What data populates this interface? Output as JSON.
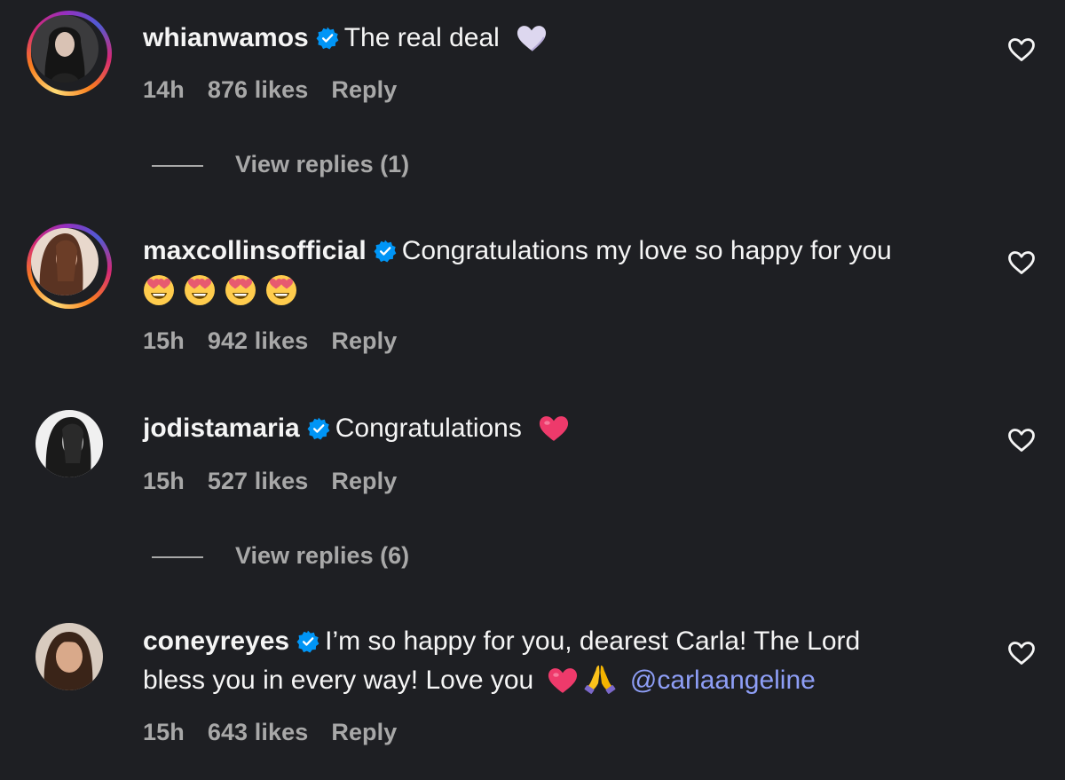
{
  "comments": [
    {
      "username": "whianwamos",
      "text": "The real deal",
      "emojis": [
        "white-heart-icon"
      ],
      "time": "14h",
      "likes": "876 likes",
      "reply": "Reply",
      "view_replies": "View replies (1)"
    },
    {
      "username": "maxcollinsofficial",
      "text": "Congratulations my love so happy for you",
      "emojis": [
        "heart-eyes-icon",
        "heart-eyes-icon",
        "heart-eyes-icon",
        "heart-eyes-icon"
      ],
      "time": "15h",
      "likes": "942 likes",
      "reply": "Reply"
    },
    {
      "username": "jodistamaria",
      "text": "Congratulations",
      "emojis": [
        "pink-heart-icon"
      ],
      "time": "15h",
      "likes": "527 likes",
      "reply": "Reply",
      "view_replies": "View replies (6)"
    },
    {
      "username": "coneyreyes",
      "text_line1": "I’m so happy for you, dearest Carla! The Lord",
      "text_line2": "bless you in every way! Love you",
      "emojis": [
        "pink-heart-icon",
        "folded-hands-icon"
      ],
      "mention": "@carlaangeline",
      "time": "15h",
      "likes": "643 likes",
      "reply": "Reply"
    }
  ],
  "colors": {
    "background": "#1e1f23",
    "text": "#f5f5f5",
    "secondary": "#a8a8a8",
    "verified": "#0095f6",
    "mention": "#8e9ef6",
    "heart": "#ee3a6b"
  }
}
